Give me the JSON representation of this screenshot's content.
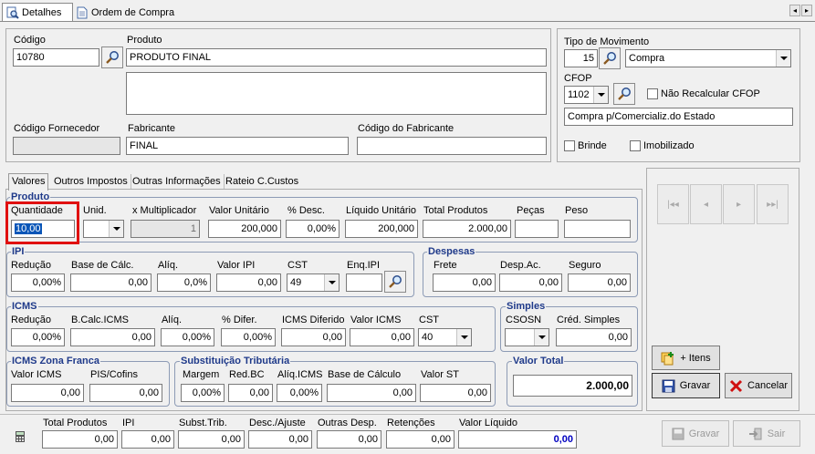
{
  "tabs": {
    "detalhes": "Detalhes",
    "ordem_compra": "Ordem de Compra"
  },
  "header": {
    "codigo_label": "Código",
    "codigo_value": "10780",
    "produto_label": "Produto",
    "produto_value": "PRODUTO FINAL",
    "cod_fornecedor_label": "Código Fornecedor",
    "cod_fornecedor_value": "",
    "fabricante_label": "Fabricante",
    "fabricante_value": "FINAL",
    "cod_fabricante_label": "Código do Fabricante",
    "cod_fabricante_value": "",
    "tipo_mov_label": "Tipo de Movimento",
    "tipo_mov_code": "15",
    "tipo_mov_value": "Compra",
    "cfop_label": "CFOP",
    "cfop_value": "1102",
    "nao_recalcular_label": "Não Recalcular CFOP",
    "cfop_desc": "Compra p/Comercializ.do Estado",
    "brinde_label": "Brinde",
    "imobilizado_label": "Imobilizado"
  },
  "subtabs": {
    "valores": "Valores",
    "outros_impostos": "Outros Impostos",
    "outras_info": "Outras Informações",
    "rateio": "Rateio C.Custos"
  },
  "produto": {
    "title": "Produto",
    "quantidade_label": "Quantidade",
    "quantidade_value": "10,00",
    "unid_label": "Unid.",
    "unid_value": "",
    "mult_label": "x Multiplicador",
    "mult_value": "1",
    "valor_unit_label": "Valor Unitário",
    "valor_unit_value": "200,000",
    "desc_label": "% Desc.",
    "desc_value": "0,00%",
    "liq_unit_label": "Líquido Unitário",
    "liq_unit_value": "200,000",
    "total_label": "Total Produtos",
    "total_value": "2.000,00",
    "pecas_label": "Peças",
    "pecas_value": "",
    "peso_label": "Peso",
    "peso_value": ""
  },
  "ipi": {
    "title": "IPI",
    "reducao_label": "Redução",
    "reducao_value": "0,00%",
    "base_label": "Base de Cálc.",
    "base_value": "0,00",
    "aliq_label": "Alíq.",
    "aliq_value": "0,0%",
    "valor_label": "Valor IPI",
    "valor_value": "0,00",
    "cst_label": "CST",
    "cst_value": "49",
    "enq_label": "Enq.IPI",
    "enq_value": ""
  },
  "despesas": {
    "title": "Despesas",
    "frete_label": "Frete",
    "frete_value": "0,00",
    "desp_label": "Desp.Ac.",
    "desp_value": "0,00",
    "seguro_label": "Seguro",
    "seguro_value": "0,00"
  },
  "icms": {
    "title": "ICMS",
    "reducao_label": "Redução",
    "reducao_value": "0,00%",
    "bcalc_label": "B.Calc.ICMS",
    "bcalc_value": "0,00",
    "aliq_label": "Alíq.",
    "aliq_value": "0,00%",
    "difer_label": "% Difer.",
    "difer_value": "0,00%",
    "diferido_label": "ICMS Diferido",
    "diferido_value": "0,00",
    "valor_label": "Valor ICMS",
    "valor_value": "0,00",
    "cst_label": "CST",
    "cst_value": "40"
  },
  "simples": {
    "title": "Simples",
    "csosn_label": "CSOSN",
    "csosn_value": "",
    "cred_label": "Créd. Simples",
    "cred_value": "0,00"
  },
  "zona_franca": {
    "title": "ICMS Zona Franca",
    "valor_label": "Valor ICMS",
    "valor_value": "0,00",
    "pis_label": "PIS/Cofins",
    "pis_value": "0,00"
  },
  "st": {
    "title": "Substituição Tributária",
    "margem_label": "Margem",
    "margem_value": "0,00%",
    "redbc_label": "Red.BC",
    "redbc_value": "0,00",
    "aliq_label": "Alíq.ICMS",
    "aliq_value": "0,00%",
    "base_label": "Base de Cálculo",
    "base_value": "0,00",
    "valor_label": "Valor ST",
    "valor_value": "0,00"
  },
  "valor_total": {
    "title": "Valor Total",
    "value": "2.000,00"
  },
  "actions": {
    "add_itens": "+ Itens",
    "gravar": "Gravar",
    "cancelar": "Cancelar"
  },
  "footer": {
    "total_produtos_label": "Total Produtos",
    "total_produtos_value": "0,00",
    "ipi_label": "IPI",
    "ipi_value": "0,00",
    "subst_label": "Subst.Trib.",
    "subst_value": "0,00",
    "desc_label": "Desc./Ajuste",
    "desc_value": "0,00",
    "outras_label": "Outras Desp.",
    "outras_value": "0,00",
    "ret_label": "Retenções",
    "ret_value": "0,00",
    "liquido_label": "Valor Líquido",
    "liquido_value": "0,00",
    "gravar": "Gravar",
    "sair": "Sair"
  },
  "colors": {
    "group_title": "#1f3a8a",
    "highlight": "#e01010",
    "liquido": "#0000c0"
  }
}
